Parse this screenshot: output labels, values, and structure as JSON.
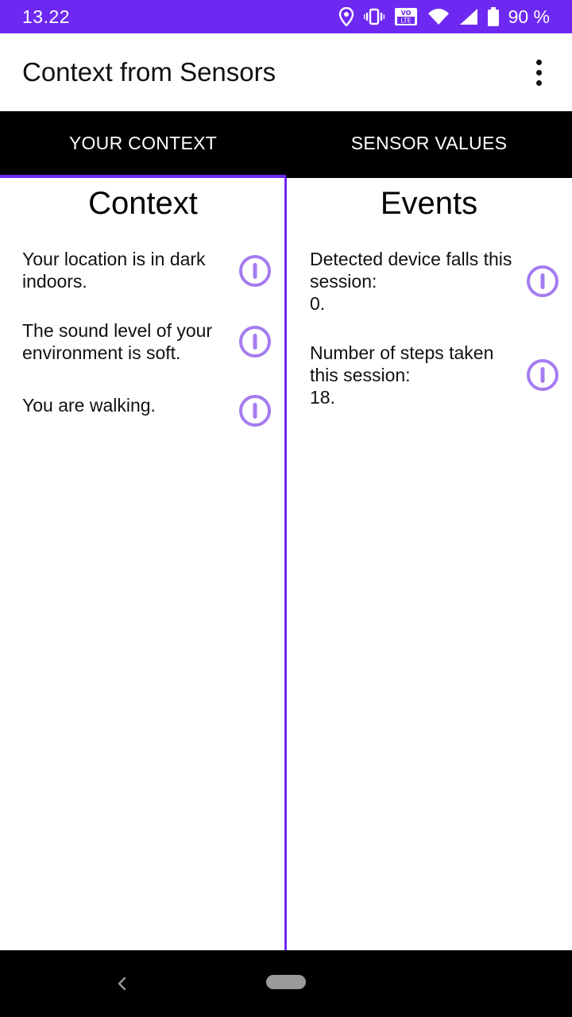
{
  "status_bar": {
    "time": "13.22",
    "battery": "90 %",
    "icons": [
      "location-icon",
      "vibrate-icon",
      "volte-icon",
      "wifi-icon",
      "cellular-signal-icon",
      "battery-icon"
    ],
    "volte_label": "VO LTE"
  },
  "app_bar": {
    "title": "Context from Sensors",
    "menu_icon": "more-vert-icon"
  },
  "tabs": [
    {
      "label": "YOUR CONTEXT",
      "active": true
    },
    {
      "label": "SENSOR VALUES",
      "active": false
    }
  ],
  "context": {
    "title": "Context",
    "items": [
      {
        "text": "Your location is in dark\nindoors.",
        "icon": "info-icon"
      },
      {
        "text": "The sound level of your\nenvironment is soft.",
        "icon": "info-icon"
      },
      {
        "text": "You are walking.",
        "icon": "info-icon"
      }
    ]
  },
  "events": {
    "title": "Events",
    "items": [
      {
        "text": "Detected device falls this\nsession:\n0.",
        "icon": "info-icon"
      },
      {
        "text": "Number of steps taken\nthis session:\n18.",
        "icon": "info-icon"
      }
    ]
  },
  "colors": {
    "accent": "#6d29f2",
    "info_icon": "#a47cf0",
    "tab_bar": "#000000"
  },
  "nav_bar": {
    "icons": [
      "back-icon",
      "home-pill-icon"
    ]
  }
}
